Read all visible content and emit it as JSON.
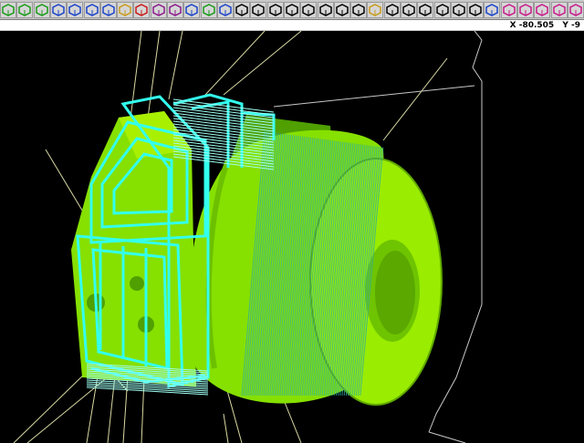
{
  "toolbar": {
    "tools": [
      {
        "name": "view-iso-icon",
        "color": "#1a9a1a"
      },
      {
        "name": "view-cube-icon",
        "color": "#1a9a1a"
      },
      {
        "name": "view-solid-icon",
        "color": "#1a9a1a"
      },
      {
        "name": "view-top-icon",
        "color": "#1b44c8"
      },
      {
        "name": "view-front-icon",
        "color": "#1b44c8"
      },
      {
        "name": "view-side-icon",
        "color": "#1b44c8"
      },
      {
        "name": "view-box-icon",
        "color": "#1b44c8"
      },
      {
        "name": "pencil-icon",
        "color": "#c89b1a"
      },
      {
        "name": "cancel-icon",
        "color": "#c81a1a"
      },
      {
        "name": "grid-snap-icon",
        "color": "#8a1a8a"
      },
      {
        "name": "transform-icon",
        "color": "#8a1a8a"
      },
      {
        "name": "undo-icon",
        "color": "#1b44c8"
      },
      {
        "name": "layers-icon",
        "color": "#1a9a1a"
      },
      {
        "name": "sphere-icon",
        "color": "#1b44c8"
      },
      {
        "name": "sigma-icon",
        "color": "#000000"
      },
      {
        "name": "line-icon",
        "color": "#000000"
      },
      {
        "name": "arc-icon",
        "color": "#000000"
      },
      {
        "name": "fillet-icon",
        "color": "#000000"
      },
      {
        "name": "spline-icon",
        "color": "#000000"
      },
      {
        "name": "rectangle-icon",
        "color": "#000000"
      },
      {
        "name": "point-icon",
        "color": "#000000"
      },
      {
        "name": "xform-icon",
        "color": "#000000"
      },
      {
        "name": "solid-icon",
        "color": "#c89b1a"
      },
      {
        "name": "chamfer-icon",
        "color": "#000000"
      },
      {
        "name": "trim-icon",
        "color": "#000000"
      },
      {
        "name": "break-icon",
        "color": "#000000"
      },
      {
        "name": "delete-cross-icon",
        "color": "#000000"
      },
      {
        "name": "divide-icon",
        "color": "#000000"
      },
      {
        "name": "arrow-icon",
        "color": "#000000"
      },
      {
        "name": "analyze-icon",
        "color": "#1b44c8"
      },
      {
        "name": "mirror-icon",
        "color": "#c81a8a"
      },
      {
        "name": "offset-icon",
        "color": "#c81a8a"
      },
      {
        "name": "project-icon",
        "color": "#c81a8a"
      },
      {
        "name": "stretch-icon",
        "color": "#c81a8a"
      },
      {
        "name": "translate-icon",
        "color": "#c81a8a"
      }
    ]
  },
  "status": {
    "x_label": "X -80.505",
    "y_label": "Y -9"
  },
  "colors": {
    "background": "#000000",
    "toolbar": "#c8c8c8",
    "solid_main": "#86e000",
    "solid_light": "#a8f000",
    "solid_dark": "#4fa000",
    "toolpath": "#33ffee",
    "wireframe": "#ffffc0",
    "stock_outline": "#c8c8c8"
  }
}
